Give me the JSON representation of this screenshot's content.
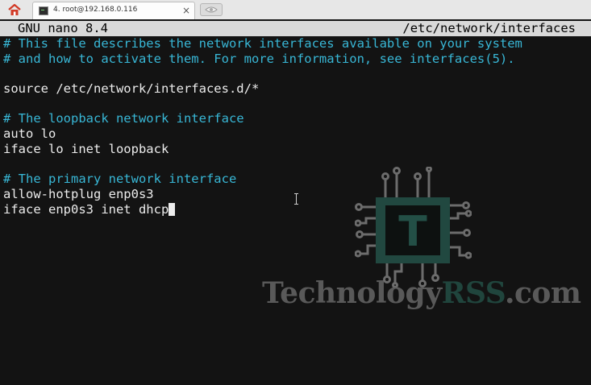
{
  "browser": {
    "tab_title": "4. root@192.168.0.116",
    "close_glyph": "×",
    "home_icon": "home-icon",
    "newtab_icon": "new-tab-icon"
  },
  "nano": {
    "app_name": "GNU nano 8.4",
    "file_path": "/etc/network/interfaces",
    "lines": [
      {
        "kind": "comment",
        "text": "# This file describes the network interfaces available on your system"
      },
      {
        "kind": "comment",
        "text": "# and how to activate them. For more information, see interfaces(5)."
      },
      {
        "kind": "code",
        "text": ""
      },
      {
        "kind": "code",
        "text": "source /etc/network/interfaces.d/*"
      },
      {
        "kind": "code",
        "text": ""
      },
      {
        "kind": "comment",
        "text": "# The loopback network interface"
      },
      {
        "kind": "code",
        "text": "auto lo"
      },
      {
        "kind": "code",
        "text": "iface lo inet loopback"
      },
      {
        "kind": "code",
        "text": ""
      },
      {
        "kind": "comment",
        "text": "# The primary network interface"
      },
      {
        "kind": "code",
        "text": "allow-hotplug enp0s3"
      },
      {
        "kind": "code",
        "text": "iface enp0s3 inet dhcp"
      }
    ],
    "cursor_line": 11
  },
  "watermark": {
    "text_part1": "Technology",
    "text_part2": "RSS",
    "text_part3": ".com",
    "chip_letter": "T"
  },
  "colors": {
    "terminal_bg": "#131313",
    "comment": "#38b7d6",
    "text": "#ececec",
    "titlebar_bg": "#d9d9d9",
    "brand_teal": "#245248"
  }
}
